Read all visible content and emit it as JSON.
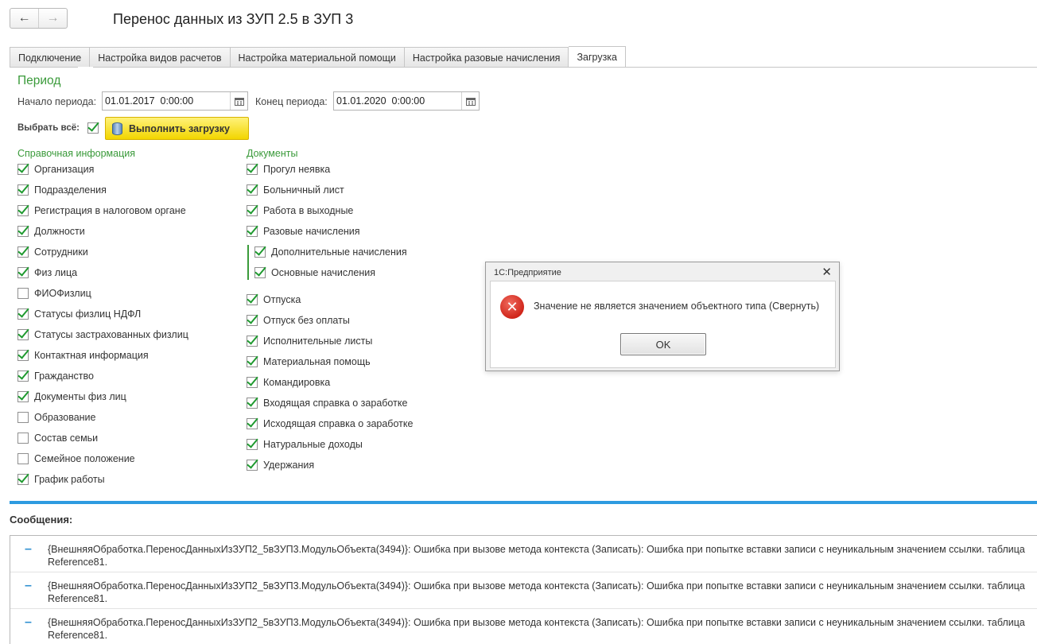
{
  "window": {
    "title": "Перенос данных из ЗУП 2.5 в ЗУП 3",
    "back_icon": "←",
    "forward_icon": "→"
  },
  "tabs": [
    {
      "label": "Подключение",
      "active": false
    },
    {
      "label": "Настройка видов расчетов",
      "active": false
    },
    {
      "label": "Настройка материальной помощи",
      "active": false
    },
    {
      "label": "Настройка разовые начисления",
      "active": false
    },
    {
      "label": "Загрузка",
      "active": true
    }
  ],
  "period": {
    "title": "Период",
    "start_label": "Начало периода:",
    "start_value": "01.01.2017  0:00:00",
    "end_label": "Конец периода:",
    "end_value": "01.01.2020  0:00:00"
  },
  "select_all": {
    "label": "Выбрать всё:",
    "checked": true
  },
  "run_button": {
    "label": "Выполнить загрузку"
  },
  "reference": {
    "title": "Справочная информация",
    "items": [
      {
        "label": "Организация",
        "checked": true
      },
      {
        "label": "Подразделения",
        "checked": true
      },
      {
        "label": "Регистрация в налоговом органе",
        "checked": true
      },
      {
        "label": "Должности",
        "checked": true
      },
      {
        "label": "Сотрудники",
        "checked": true
      },
      {
        "label": "Физ лица",
        "checked": true
      },
      {
        "label": "ФИОФизлиц",
        "checked": false
      },
      {
        "label": "Статусы физлиц НДФЛ",
        "checked": true
      },
      {
        "label": "Статусы застрахованных физлиц",
        "checked": true
      },
      {
        "label": "Контактная информация",
        "checked": true
      },
      {
        "label": "Гражданство",
        "checked": true
      },
      {
        "label": "Документы физ лиц",
        "checked": true
      },
      {
        "label": "Образование",
        "checked": false
      },
      {
        "label": "Состав семьи",
        "checked": false
      },
      {
        "label": "Семейное положение",
        "checked": false
      },
      {
        "label": "График работы",
        "checked": true
      }
    ]
  },
  "documents": {
    "title": "Документы",
    "items": [
      {
        "label": "Прогул неявка",
        "checked": true
      },
      {
        "label": "Больничный лист",
        "checked": true
      },
      {
        "label": "Работа в выходные",
        "checked": true
      },
      {
        "label": "Разовые начисления",
        "checked": true
      }
    ],
    "sub_items": [
      {
        "label": "Дополнительные начисления",
        "checked": true
      },
      {
        "label": "Основные начисления",
        "checked": true
      }
    ],
    "items2": [
      {
        "label": "Отпуска",
        "checked": true
      },
      {
        "label": "Отпуск без оплаты",
        "checked": true
      },
      {
        "label": "Исполнительные листы",
        "checked": true
      },
      {
        "label": "Материальная помощь",
        "checked": true
      },
      {
        "label": "Командировка",
        "checked": true
      },
      {
        "label": "Входящая справка о заработке",
        "checked": true
      },
      {
        "label": "Исходящая справка о заработке",
        "checked": true
      },
      {
        "label": "Натуральные доходы",
        "checked": true
      },
      {
        "label": "Удержания",
        "checked": true
      }
    ]
  },
  "messages": {
    "title": "Сообщения:",
    "items": [
      {
        "text": "{ВнешняяОбработка.ПереносДанныхИзЗУП2_5вЗУП3.МодульОбъекта(3494)}: Ошибка при вызове метода контекста (Записать): Ошибка при попытке вставки записи с неуникальным значением ссылки. таблица Reference81."
      },
      {
        "text": "{ВнешняяОбработка.ПереносДанныхИзЗУП2_5вЗУП3.МодульОбъекта(3494)}: Ошибка при вызове метода контекста (Записать): Ошибка при попытке вставки записи с неуникальным значением ссылки. таблица Reference81."
      },
      {
        "text": "{ВнешняяОбработка.ПереносДанныхИзЗУП2_5вЗУП3.МодульОбъекта(3494)}: Ошибка при вызове метода контекста (Записать): Ошибка при попытке вставки записи с неуникальным значением ссылки. таблица Reference81."
      }
    ]
  },
  "dialog": {
    "title": "1С:Предприятие",
    "close_icon": "✕",
    "error_icon": "✕",
    "message": "Значение не является значением объектного типа (Свернуть)",
    "ok_label": "OK"
  }
}
